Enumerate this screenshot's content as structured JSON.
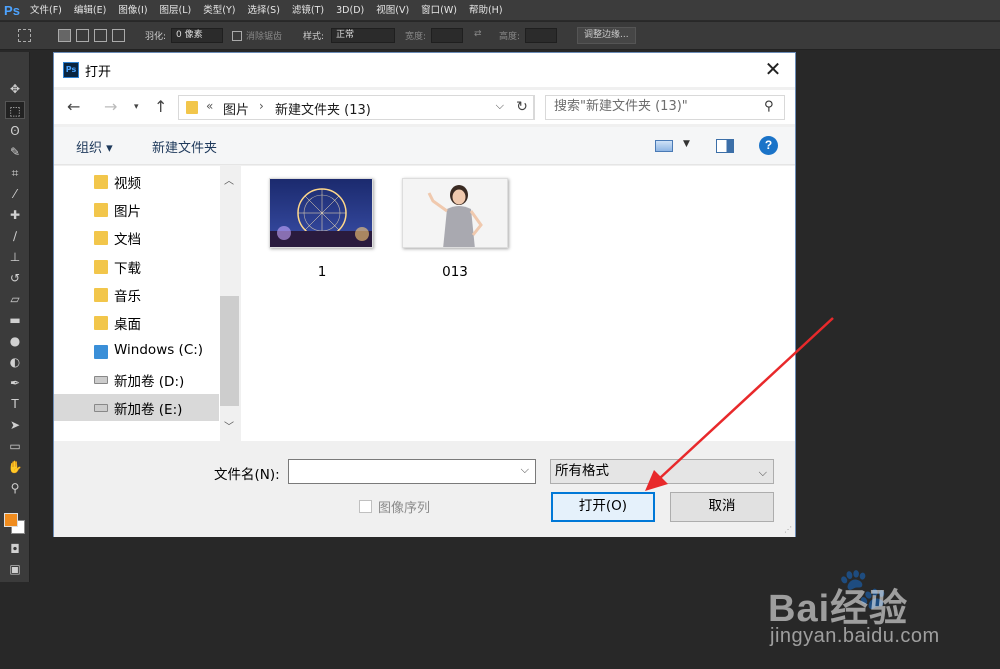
{
  "app": {
    "logo": "Ps",
    "menu": [
      "文件(F)",
      "编辑(E)",
      "图像(I)",
      "图层(L)",
      "类型(Y)",
      "选择(S)",
      "滤镜(T)",
      "3D(D)",
      "视图(V)",
      "窗口(W)",
      "帮助(H)"
    ],
    "options": {
      "feather_label": "羽化:",
      "feather_value": "0 像素",
      "antialias_label": "消除锯齿",
      "style_label": "样式:",
      "style_value": "正常",
      "width_label": "宽度:",
      "height_label": "高度:",
      "refine_edge": "调整边缘..."
    },
    "tools": [
      "move-icon",
      "marquee-icon",
      "lasso-icon",
      "quick-select-icon",
      "crop-icon",
      "eyedropper-icon",
      "healing-brush-icon",
      "brush-icon",
      "clone-stamp-icon",
      "history-brush-icon",
      "eraser-icon",
      "gradient-icon",
      "blur-icon",
      "dodge-icon",
      "pen-icon",
      "type-icon",
      "path-select-icon",
      "shape-icon",
      "hand-icon",
      "zoom-icon"
    ],
    "colors": {
      "foreground": "#f08c1e",
      "background": "#ffffff",
      "accent": "#0078d7"
    }
  },
  "dialog": {
    "title": "打开",
    "address": {
      "sep": "«",
      "crumbs": [
        "图片",
        "新建文件夹 (13)"
      ]
    },
    "search_placeholder": "搜索\"新建文件夹 (13)\"",
    "commands": {
      "organize": "组织 ▾",
      "new_folder": "新建文件夹"
    },
    "nav_items": [
      {
        "label": "视频",
        "icon": "video-folder-icon"
      },
      {
        "label": "图片",
        "icon": "pictures-folder-icon"
      },
      {
        "label": "文档",
        "icon": "documents-folder-icon"
      },
      {
        "label": "下载",
        "icon": "downloads-folder-icon"
      },
      {
        "label": "音乐",
        "icon": "music-folder-icon"
      },
      {
        "label": "桌面",
        "icon": "desktop-folder-icon"
      },
      {
        "label": "Windows (C:)",
        "icon": "system-drive-icon"
      },
      {
        "label": "新加卷 (D:)",
        "icon": "drive-icon"
      },
      {
        "label": "新加卷 (E:)",
        "icon": "drive-icon",
        "selected": true
      }
    ],
    "files": [
      {
        "name": "1",
        "thumb": "ferris-wheel-night-photo"
      },
      {
        "name": "013",
        "thumb": "woman-portrait-photo"
      }
    ],
    "filename_label": "文件名(N):",
    "filename_value": "",
    "filetype_value": "所有格式",
    "sequence_label": "图像序列",
    "open_button": "打开(O)",
    "cancel_button": "取消"
  },
  "watermark": {
    "main": "Bai经验",
    "sub": "jingyan.baidu.com"
  }
}
